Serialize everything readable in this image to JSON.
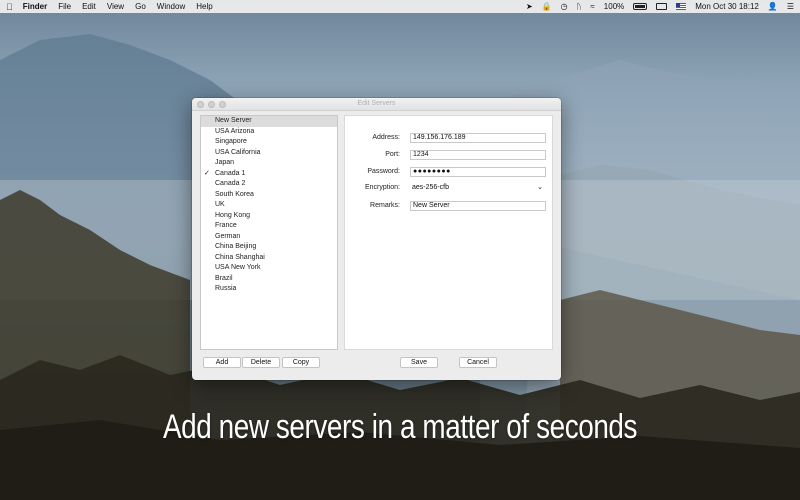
{
  "menubar": {
    "apple_icon": "apple-icon",
    "app_name": "Finder",
    "menus": [
      "File",
      "Edit",
      "View",
      "Go",
      "Window",
      "Help"
    ],
    "battery_percent": "100%",
    "datetime": "Mon Oct 30  18:12"
  },
  "window": {
    "title": "Edit Servers",
    "servers": [
      {
        "name": "New Server",
        "selected": true,
        "checked": false
      },
      {
        "name": "USA Arizona",
        "selected": false,
        "checked": false
      },
      {
        "name": "Singapore",
        "selected": false,
        "checked": false
      },
      {
        "name": "USA California",
        "selected": false,
        "checked": false
      },
      {
        "name": "Japan",
        "selected": false,
        "checked": false
      },
      {
        "name": "Canada 1",
        "selected": false,
        "checked": true
      },
      {
        "name": "Canada 2",
        "selected": false,
        "checked": false
      },
      {
        "name": "South Korea",
        "selected": false,
        "checked": false
      },
      {
        "name": "UK",
        "selected": false,
        "checked": false
      },
      {
        "name": "Hong Kong",
        "selected": false,
        "checked": false
      },
      {
        "name": "France",
        "selected": false,
        "checked": false
      },
      {
        "name": "German",
        "selected": false,
        "checked": false
      },
      {
        "name": "China Beijing",
        "selected": false,
        "checked": false
      },
      {
        "name": "China Shanghai",
        "selected": false,
        "checked": false
      },
      {
        "name": "USA New York",
        "selected": false,
        "checked": false
      },
      {
        "name": "Brazil",
        "selected": false,
        "checked": false
      },
      {
        "name": "Russia",
        "selected": false,
        "checked": false
      }
    ],
    "check_mark": "✓",
    "form": {
      "address_label": "Address:",
      "address_value": "149.156.176.189",
      "port_label": "Port:",
      "port_value": "1234",
      "password_label": "Password:",
      "password_value": "●●●●●●●●",
      "encryption_label": "Encryption:",
      "encryption_value": "aes-256-cfb",
      "remarks_label": "Remarks:",
      "remarks_value": "New Server"
    },
    "buttons": {
      "add": "Add",
      "delete": "Delete",
      "copy": "Copy",
      "save": "Save",
      "cancel": "Cancel"
    }
  },
  "caption": "Add new servers in a matter of seconds"
}
